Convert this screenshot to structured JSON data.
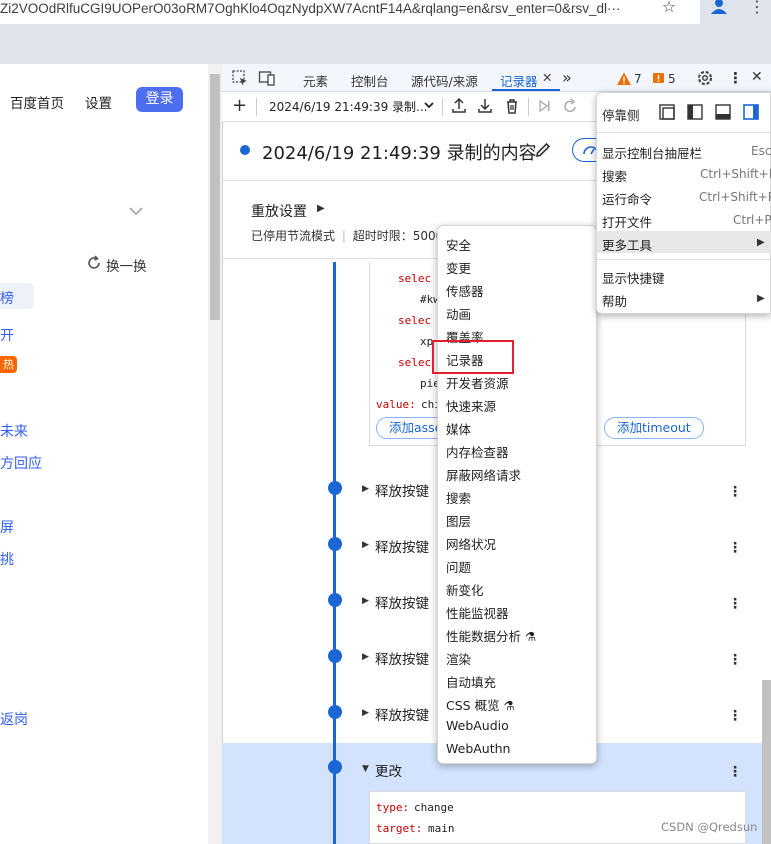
{
  "browser": {
    "url": "Zi2VOOdRlfuCGI9UOPerO03oRM7OghKlo4OqzNydpXW7AcntF14A&rqlang=en&rsv_enter=0&rsv_dl···",
    "icons": [
      "star-icon",
      "account-icon",
      "more-vert-icon"
    ]
  },
  "page": {
    "nav_home": "百度首页",
    "nav_settings": "设置",
    "login": "登录",
    "refresh_label": "换一换",
    "hot_tab": "榜",
    "hot_badge": "热",
    "links": [
      "开",
      "未来",
      "方回应",
      "屏",
      "挑",
      "返岗"
    ]
  },
  "devtools": {
    "tabs": [
      "元素",
      "控制台",
      "源代码/来源",
      "记录器"
    ],
    "active_tab": "记录器",
    "more_tabs": "»",
    "warnings": "7",
    "issues": "5",
    "accent": "#1a66d2"
  },
  "recorder": {
    "select_label": "2024/6/19 21:49:39 录制...",
    "title": "2024/6/19 21:49:39 录制的内容",
    "replay_title": "重放设置",
    "replay_throttle": "已停用节流模式",
    "replay_timeout": "超时时限：5000",
    "code_lines": [
      {
        "k": "selec",
        "v": ""
      },
      {
        "k": "",
        "v": "#kw"
      },
      {
        "k": "selec",
        "v": ""
      },
      {
        "k": "",
        "v": "xp"
      },
      {
        "k": "selec",
        "v": ""
      },
      {
        "k": "",
        "v": "pie"
      },
      {
        "k": "value:",
        "v": "chi"
      }
    ],
    "add_assert": "添加asse",
    "add_timeout": "添加timeout",
    "steps": [
      "释放按键",
      "释放按键",
      "释放按键",
      "释放按键",
      "释放按键"
    ],
    "change_step": "更改",
    "change_code": [
      {
        "k": "type:",
        "v": "change"
      },
      {
        "k": "target:",
        "v": "main"
      }
    ]
  },
  "more_tools_menu": {
    "items": [
      "安全",
      "变更",
      "传感器",
      "动画",
      "覆盖率",
      "记录器",
      "开发者资源",
      "快速来源",
      "媒体",
      "内存检查器",
      "屏蔽网络请求",
      "搜索",
      "图层",
      "网络状况",
      "问题",
      "新变化",
      "性能监视器",
      "性能数据分析 ⚗",
      "渲染",
      "自动填充",
      "CSS 概览 ⚗",
      "WebAudio",
      "WebAuthn"
    ],
    "highlighted": "记录器",
    "highlight_color": "#e0202f"
  },
  "settings_menu": {
    "dock_label": "停靠侧",
    "items": [
      {
        "label": "显示控制台抽屉栏",
        "shortcut": "Esc"
      },
      {
        "label": "搜索",
        "shortcut": "Ctrl+Shift+F"
      },
      {
        "label": "运行命令",
        "shortcut": "Ctrl+Shift+P"
      },
      {
        "label": "打开文件",
        "shortcut": "Ctrl+P"
      },
      {
        "label": "更多工具",
        "shortcut": "▶"
      }
    ],
    "shortcuts_label": "显示快捷键",
    "help_label": "帮助"
  },
  "watermark": "CSDN @Qredsun"
}
